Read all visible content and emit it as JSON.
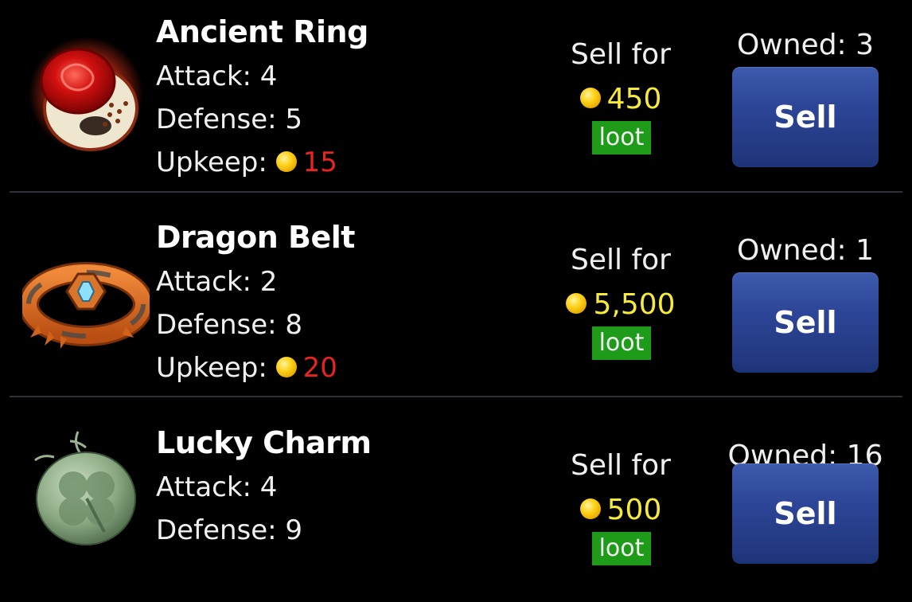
{
  "items": [
    {
      "name": "Ancient Ring",
      "attack": "Attack: 4",
      "defense": "Defense: 5",
      "upkeep_label": "Upkeep:",
      "upkeep_value": "15",
      "sell_for_label": "Sell for",
      "price": "450",
      "loot_badge": "loot",
      "owned": "Owned: 3",
      "sell_button": "Sell",
      "icon": "ring-icon"
    },
    {
      "name": "Dragon Belt",
      "attack": "Attack: 2",
      "defense": "Defense: 8",
      "upkeep_label": "Upkeep:",
      "upkeep_value": "20",
      "sell_for_label": "Sell for",
      "price": "5,500",
      "loot_badge": "loot",
      "owned": "Owned: 1",
      "sell_button": "Sell",
      "icon": "belt-icon"
    },
    {
      "name": "Lucky Charm",
      "attack": "Attack: 4",
      "defense": "Defense: 9",
      "sell_for_label": "Sell for",
      "price": "500",
      "loot_badge": "loot",
      "owned": "Owned: 16",
      "sell_button": "Sell",
      "icon": "clover-charm-icon"
    }
  ],
  "colors": {
    "background": "#000000",
    "price": "#f6ea3a",
    "upkeep": "#e8241e",
    "loot_badge": "#1f9b1a",
    "sell_button": "#2d4597",
    "coin": "#ffd21a"
  }
}
